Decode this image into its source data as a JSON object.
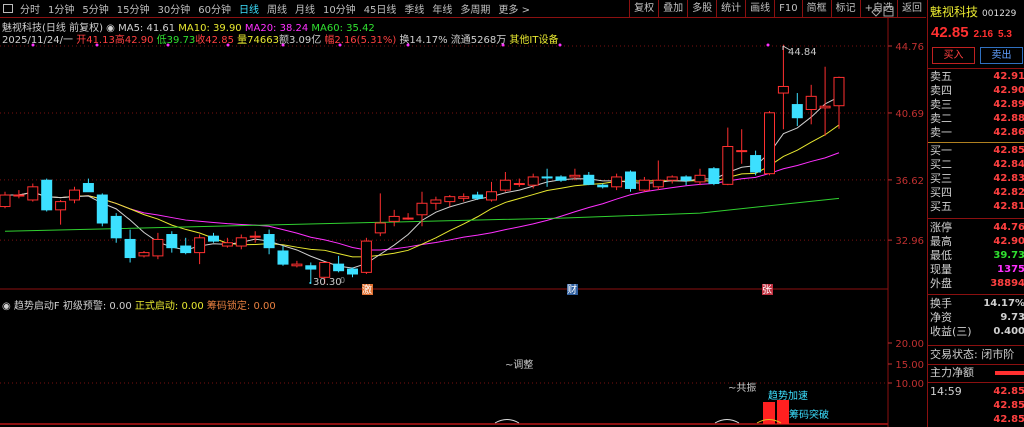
{
  "toolbar": {
    "tabs": [
      "分时",
      "1分钟",
      "5分钟",
      "15分钟",
      "30分钟",
      "60分钟",
      "日线",
      "周线",
      "月线",
      "10分钟",
      "45日线",
      "季线",
      "年线",
      "多周期",
      "更多 >"
    ],
    "active": "日线",
    "tools": [
      "复权",
      "叠加",
      "多股",
      "统计",
      "画线",
      "F10",
      "简框",
      "标记",
      "+自选",
      "返回"
    ]
  },
  "info": {
    "name": "魅视科技(日线 前复权)",
    "ma5": "MA5: 41.61",
    "ma10": "MA10: 39.90",
    "ma20": "MA20: 38.24",
    "ma60": "MA60: 35.42",
    "date": "2025/11/24/一",
    "open": "开41.13",
    "high": "高42.90",
    "low": "低39.73",
    "close": "收42.85",
    "vol": "量74663",
    "amount": "额3.09亿",
    "change": "幅2.16(5.31%)",
    "turnover": "换14.17%",
    "float": "流通5268万",
    "sector": "其他IT设备"
  },
  "indicator": {
    "name": "趋势启动F",
    "warn": "初级预警: 0.00",
    "start": "正式启动: 0.00",
    "lock": "筹码锁定: 0.00",
    "axis": [
      "20.00",
      "15.00",
      "10.00"
    ],
    "labels": {
      "adjust": "~调整",
      "resonance": "~共振",
      "accel": "趋势加速",
      "breakout": "筹码突破"
    }
  },
  "markers": {
    "ji": "激",
    "cai": "财",
    "zhang": "张",
    "low_label": "30.30",
    "high_label": "44.84",
    "zero": "0"
  },
  "chart_data": {
    "type": "candlestick",
    "price_axis": [
      "44.76",
      "40.69",
      "36.62",
      "32.96"
    ],
    "ylim": [
      30.0,
      45.5
    ],
    "candles": [
      [
        35.0,
        35.9,
        34.9,
        35.7
      ],
      [
        35.7,
        36.0,
        35.5,
        35.7
      ],
      [
        35.4,
        36.4,
        35.3,
        36.2
      ],
      [
        36.6,
        36.7,
        34.7,
        34.8
      ],
      [
        34.8,
        35.4,
        33.9,
        35.3
      ],
      [
        35.4,
        36.2,
        35.2,
        36.0
      ],
      [
        36.4,
        36.7,
        35.9,
        35.9
      ],
      [
        35.7,
        35.8,
        33.8,
        34.0
      ],
      [
        34.4,
        34.6,
        32.8,
        33.1
      ],
      [
        33.0,
        33.6,
        31.6,
        31.9
      ],
      [
        32.0,
        32.3,
        31.9,
        32.2
      ],
      [
        32.0,
        33.4,
        31.8,
        33.0
      ],
      [
        33.3,
        33.5,
        32.2,
        32.5
      ],
      [
        32.6,
        33.1,
        32.1,
        32.2
      ],
      [
        32.2,
        33.3,
        31.5,
        33.1
      ],
      [
        33.2,
        33.4,
        32.8,
        32.9
      ],
      [
        32.6,
        33.1,
        32.5,
        32.8
      ],
      [
        32.6,
        33.3,
        32.4,
        33.1
      ],
      [
        33.2,
        33.5,
        32.8,
        33.2
      ],
      [
        33.3,
        33.6,
        32.1,
        32.5
      ],
      [
        32.3,
        32.6,
        31.4,
        31.5
      ],
      [
        31.4,
        31.7,
        31.3,
        31.5
      ],
      [
        31.4,
        31.6,
        30.3,
        31.2
      ],
      [
        30.7,
        31.6,
        30.3,
        31.6
      ],
      [
        31.5,
        32.0,
        31.0,
        31.1
      ],
      [
        31.2,
        31.3,
        30.7,
        30.9
      ],
      [
        31.0,
        33.1,
        30.9,
        32.9
      ],
      [
        33.4,
        35.8,
        33.2,
        34.0
      ],
      [
        34.1,
        34.8,
        33.8,
        34.4
      ],
      [
        34.3,
        34.6,
        34.2,
        34.3
      ],
      [
        34.5,
        35.9,
        33.8,
        35.2
      ],
      [
        35.2,
        35.6,
        34.8,
        35.4
      ],
      [
        35.3,
        35.7,
        35.0,
        35.6
      ],
      [
        35.5,
        35.8,
        35.3,
        35.6
      ],
      [
        35.7,
        35.9,
        35.4,
        35.5
      ],
      [
        35.4,
        36.5,
        35.3,
        35.9
      ],
      [
        36.0,
        37.1,
        35.9,
        36.6
      ],
      [
        36.4,
        36.7,
        36.2,
        36.4
      ],
      [
        36.3,
        37.0,
        36.1,
        36.8
      ],
      [
        36.8,
        37.3,
        36.2,
        36.75
      ],
      [
        36.8,
        36.9,
        36.5,
        36.6
      ],
      [
        36.8,
        37.3,
        36.6,
        36.9
      ],
      [
        36.9,
        37.1,
        36.3,
        36.35
      ],
      [
        36.3,
        36.4,
        36.1,
        36.2
      ],
      [
        36.2,
        37.0,
        36.0,
        36.8
      ],
      [
        37.1,
        37.2,
        35.9,
        36.1
      ],
      [
        36.0,
        36.8,
        35.9,
        36.6
      ],
      [
        36.2,
        37.8,
        36.0,
        36.6
      ],
      [
        36.6,
        36.9,
        36.4,
        36.8
      ],
      [
        36.8,
        36.9,
        36.3,
        36.6
      ],
      [
        36.5,
        37.3,
        36.3,
        36.9
      ],
      [
        37.3,
        37.4,
        36.3,
        36.4
      ],
      [
        36.35,
        39.8,
        36.3,
        38.65
      ],
      [
        38.4,
        39.7,
        37.6,
        38.4
      ],
      [
        38.1,
        38.4,
        36.9,
        37.1
      ],
      [
        37.0,
        40.8,
        36.9,
        40.7
      ],
      [
        41.9,
        44.84,
        39.7,
        42.3
      ],
      [
        41.2,
        41.9,
        39.9,
        40.4
      ],
      [
        40.9,
        42.4,
        40.0,
        41.7
      ],
      [
        41.0,
        43.5,
        39.3,
        41.1
      ],
      [
        41.13,
        42.9,
        39.73,
        42.85
      ]
    ],
    "ma60": [
      [
        0,
        33.5
      ],
      [
        20,
        33.9
      ],
      [
        40,
        34.3
      ],
      [
        50,
        34.6
      ],
      [
        60,
        35.5
      ]
    ],
    "colors": {
      "up": "#ff3030",
      "down": "#3ce0ff",
      "ma5": "#d0d0d0",
      "ma10": "#e8e830",
      "ma20": "#ff30ff",
      "ma60": "#30d030"
    }
  },
  "panel": {
    "name": "魅视科技",
    "code": "001229",
    "price": "42.85",
    "chg": "2.16",
    "pct": "5.3",
    "buy": "买入",
    "sell": "卖出",
    "asks": [
      {
        "l": "卖五",
        "v": "42.91"
      },
      {
        "l": "卖四",
        "v": "42.90"
      },
      {
        "l": "卖三",
        "v": "42.89"
      },
      {
        "l": "卖二",
        "v": "42.88"
      },
      {
        "l": "卖一",
        "v": "42.86"
      }
    ],
    "bids": [
      {
        "l": "买一",
        "v": "42.85"
      },
      {
        "l": "买二",
        "v": "42.84"
      },
      {
        "l": "买三",
        "v": "42.83"
      },
      {
        "l": "买四",
        "v": "42.82"
      },
      {
        "l": "买五",
        "v": "42.81"
      }
    ],
    "stats": [
      {
        "l": "涨停",
        "v": "44.76",
        "c": "r"
      },
      {
        "l": "最高",
        "v": "42.90",
        "c": "r"
      },
      {
        "l": "最低",
        "v": "39.73",
        "c": "g"
      },
      {
        "l": "现量",
        "v": "1375",
        "c": "m"
      },
      {
        "l": "外盘",
        "v": "38894",
        "c": "r"
      }
    ],
    "stats2": [
      {
        "l": "换手",
        "v": "14.17%"
      },
      {
        "l": "净资",
        "v": "9.73"
      },
      {
        "l": "收益(三)",
        "v": "0.400"
      }
    ],
    "status": "交易状态: 闭市阶",
    "mainflow": "主力净额",
    "ticks": [
      {
        "t": "14:59",
        "v": "42.85"
      },
      {
        "t": "",
        "v": "42.85"
      },
      {
        "t": "",
        "v": "42.85"
      }
    ]
  }
}
